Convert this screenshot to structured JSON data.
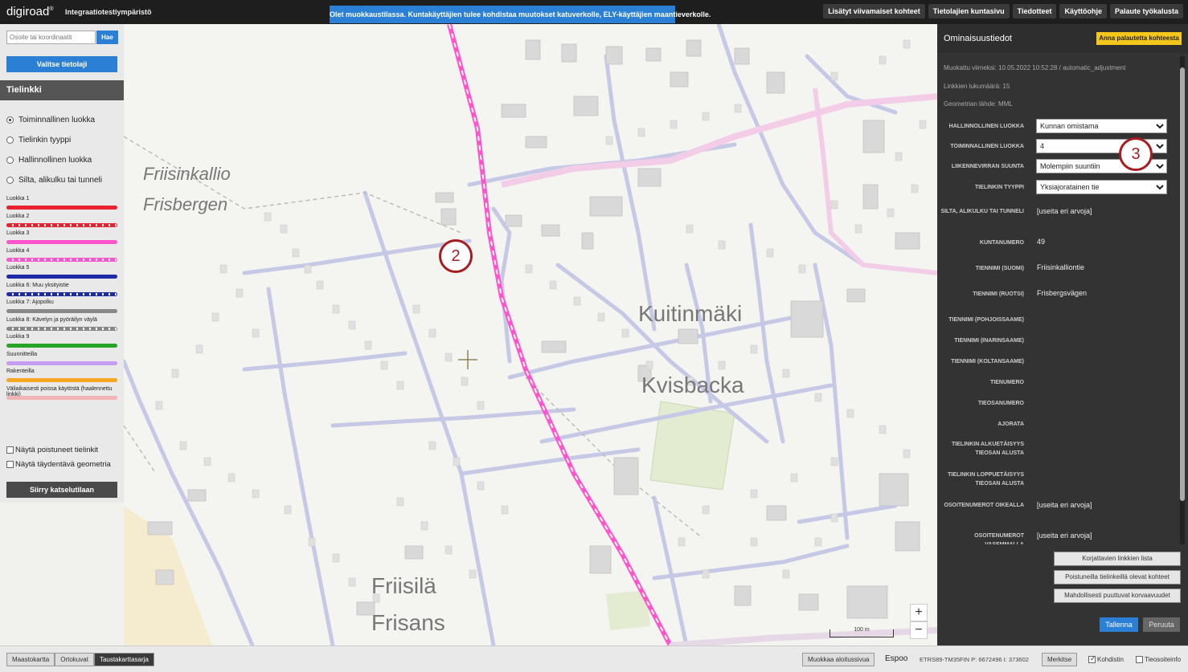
{
  "app": {
    "logo": "digiroad",
    "logo_mark": "®",
    "environment": "Integraatiotestiympäristö"
  },
  "banner": "Olet muokkaustilassa. Kuntakäyttäjien tulee kohdistaa muutokset katuverkolle, ELY-käyttäjien maantieverkolle.",
  "topnav": [
    "Lisätyt viivamaiset kohteet",
    "Tietolajien kuntasivu",
    "Tiedotteet",
    "Käyttöohje",
    "Palaute työkalusta"
  ],
  "search": {
    "placeholder": "Osoite tai koordinaatit",
    "button": "Hae"
  },
  "valitse_button": "Valitse tietolaji",
  "panel_title": "Tielinkki",
  "radios": [
    {
      "label": "Toiminnallinen luokka",
      "selected": true
    },
    {
      "label": "Tielinkin tyyppi",
      "selected": false
    },
    {
      "label": "Hallinnollinen luokka",
      "selected": false
    },
    {
      "label": "Silta, alikulku tai tunneli",
      "selected": false
    }
  ],
  "legend": [
    {
      "label": "Luokka 1",
      "color": "#e8232f",
      "style": "solid"
    },
    {
      "label": "Luokka 2",
      "color": "#e8232f",
      "style": "dashed"
    },
    {
      "label": "Luokka 3",
      "color": "#ff55cc",
      "style": "solid"
    },
    {
      "label": "Luokka 4",
      "color": "#ff55cc",
      "style": "dashed"
    },
    {
      "label": "Luokka 5",
      "color": "#1f2ba6",
      "style": "solid"
    },
    {
      "label": "Luokka 6: Muu yksityistie",
      "color": "#1f2ba6",
      "style": "dashed"
    },
    {
      "label": "Luokka 7: Ajopolku",
      "color": "#888888",
      "style": "solid"
    },
    {
      "label": "Luokka 8: Kävelyn ja pyöräilyn väylä",
      "color": "#888888",
      "style": "dashed"
    },
    {
      "label": "Luokka 9",
      "color": "#28a428",
      "style": "solid"
    },
    {
      "label": "Suunnitteilla",
      "color": "#c79bf2",
      "style": "solid"
    },
    {
      "label": "Rakenteilla",
      "color": "#f5a623",
      "style": "solid"
    },
    {
      "label": "Väliaikaisesti poissa käytöstä (haalennettu linkki)",
      "color": "#f2b5b5",
      "style": "solid"
    }
  ],
  "checks": [
    "Näytä poistuneet tielinkit",
    "Näytä täydentävä geometria"
  ],
  "siirry_button": "Siirry katselutilaan",
  "map_labels": {
    "place1": "Friisinkallio",
    "place2": "Frisbergen",
    "district1": "Kuitinmäki",
    "district2": "Kvisbacka",
    "place3": "Friisilä",
    "place4": "Frisans"
  },
  "markers": [
    "2",
    "3"
  ],
  "scale": "100 m",
  "zoom": {
    "in": "+",
    "out": "−"
  },
  "props": {
    "title": "Ominaisuustiedot",
    "feedback_button": "Anna palautetta kohteesta",
    "modified": "Muokattu viimeksi: 10.05.2022 10:52:28 / automatic_adjustment",
    "link_count": "Linkkien lukumäärä: 15",
    "geometry_source": "Geometrian lähde: MML",
    "fields": [
      {
        "label": "HALLINNOLLINEN LUOKKA",
        "type": "select",
        "value": "Kunnan omistama"
      },
      {
        "label": "TOIMINNALLINEN LUOKKA",
        "type": "select",
        "value": "4"
      },
      {
        "label": "LIIKENNEVIRRAN SUUNTA",
        "type": "select",
        "value": "Molempiin suuntiin"
      },
      {
        "label": "TIELINKIN TYYPPI",
        "type": "select",
        "value": "Yksiajoratainen tie"
      },
      {
        "label": "SILTA, ALIKULKU TAI TUNNELI",
        "type": "text",
        "value": "[useita eri arvoja]"
      },
      {
        "label": "KUNTANUMERO",
        "type": "text",
        "value": "49"
      },
      {
        "label": "TIENNIMI (SUOMI)",
        "type": "text",
        "value": "Friisinkalliontie"
      },
      {
        "label": "TIENNIMI (RUOTSI)",
        "type": "text",
        "value": "Frisbergsvägen"
      },
      {
        "label": "TIENNIMI (POHJOISSAAME)",
        "type": "text",
        "value": ""
      },
      {
        "label": "TIENNIMI (INARINSAAME)",
        "type": "text",
        "value": ""
      },
      {
        "label": "TIENNIMI (KOLTANSAAME)",
        "type": "text",
        "value": ""
      },
      {
        "label": "TIENUMERO",
        "type": "text",
        "value": ""
      },
      {
        "label": "TIEOSANUMERO",
        "type": "text",
        "value": ""
      },
      {
        "label": "AJORATA",
        "type": "text",
        "value": ""
      },
      {
        "label": "TIELINKIN ALKUETÄISYYS TIEOSAN ALUSTA",
        "type": "text",
        "value": ""
      },
      {
        "label": "TIELINKIN LOPPUETÄISYYS TIEOSAN ALUSTA",
        "type": "text",
        "value": ""
      },
      {
        "label": "OSOITENUMEROT OIKEALLA",
        "type": "text",
        "value": "[useita eri arvoja]"
      },
      {
        "label": "OSOITENUMEROT VASEMMALLA",
        "type": "text",
        "value": "[useita eri arvoja]"
      }
    ],
    "list_buttons": [
      "Korjattavien linkkien lista",
      "Poistuneilla tielinkeillä olevat kohteet",
      "Mahdollisesti puuttuvat korvaavuudet"
    ],
    "save": "Tallenna",
    "cancel": "Peruuta"
  },
  "bottom": {
    "basemaps": [
      {
        "label": "Maastokartta",
        "active": false
      },
      {
        "label": "Ortokuvat",
        "active": false
      },
      {
        "label": "Taustakarttasarja",
        "active": true
      }
    ],
    "muokkaa": "Muokkaa aloitussivua",
    "municipality": "Espoo",
    "coords": "ETRS89-TM35FIN  P: 6672496  I: 373602",
    "merkitse": "Merkitse",
    "kohdistin": "Kohdistin",
    "tieosoiteinfo": "Tieosoiteinfo"
  }
}
